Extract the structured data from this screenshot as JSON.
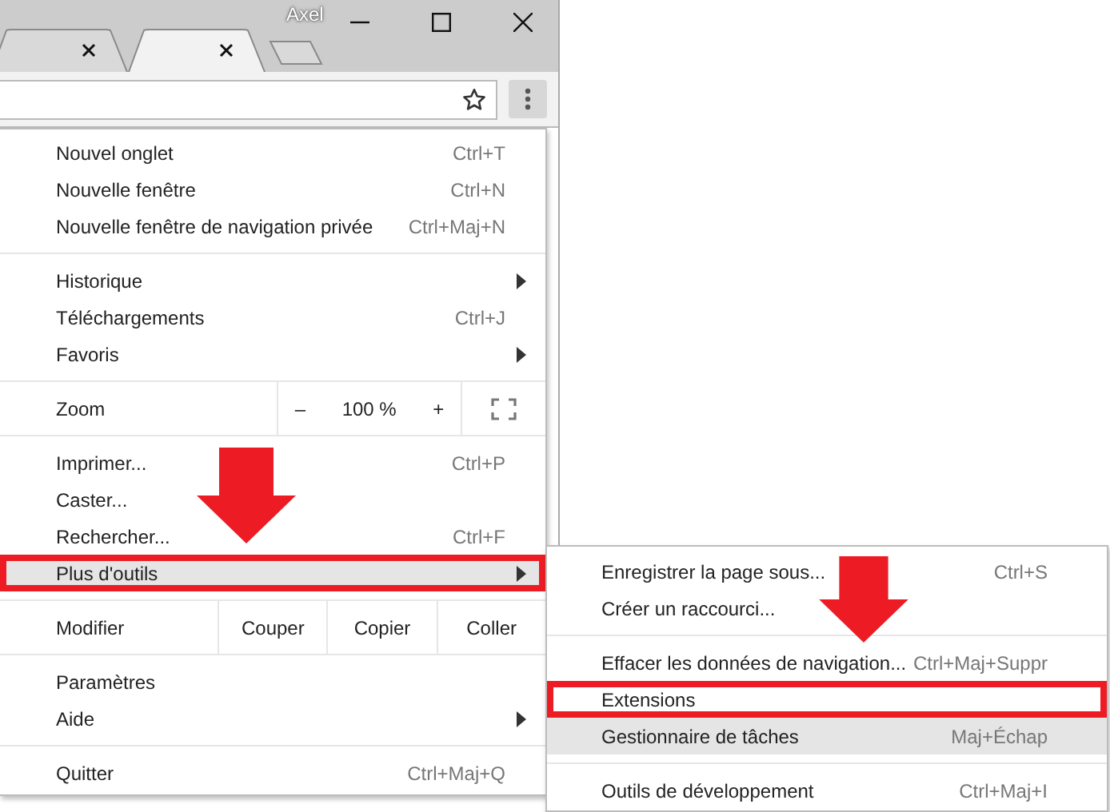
{
  "window": {
    "user": "Axel"
  },
  "tabs": [
    {
      "selected": false
    },
    {
      "selected": true
    }
  ],
  "menu": {
    "items": [
      {
        "kind": "item",
        "label": "Nouvel onglet",
        "shortcut": "Ctrl+T",
        "submenu": false,
        "highlighted": false,
        "outlined": false
      },
      {
        "kind": "item",
        "label": "Nouvelle fenêtre",
        "shortcut": "Ctrl+N",
        "submenu": false,
        "highlighted": false,
        "outlined": false
      },
      {
        "kind": "item",
        "label": "Nouvelle fenêtre de navigation privée",
        "shortcut": "Ctrl+Maj+N",
        "submenu": false,
        "highlighted": false,
        "outlined": false
      },
      {
        "kind": "separator"
      },
      {
        "kind": "item",
        "label": "Historique",
        "submenu": true,
        "highlighted": false,
        "outlined": false
      },
      {
        "kind": "item",
        "label": "Téléchargements",
        "shortcut": "Ctrl+J",
        "submenu": false,
        "highlighted": false,
        "outlined": false
      },
      {
        "kind": "item",
        "label": "Favoris",
        "submenu": true,
        "highlighted": false,
        "outlined": false
      },
      {
        "kind": "separator"
      },
      {
        "kind": "zoom",
        "label": "Zoom",
        "minus": "–",
        "value": "100 %",
        "plus": "+"
      },
      {
        "kind": "separator"
      },
      {
        "kind": "item",
        "label": "Imprimer...",
        "shortcut": "Ctrl+P",
        "submenu": false,
        "highlighted": false,
        "outlined": false
      },
      {
        "kind": "item",
        "label": "Caster...",
        "submenu": false,
        "highlighted": false,
        "outlined": false
      },
      {
        "kind": "item",
        "label": "Rechercher...",
        "shortcut": "Ctrl+F",
        "submenu": false,
        "highlighted": false,
        "outlined": false
      },
      {
        "kind": "item",
        "label": "Plus d'outils",
        "submenu": true,
        "highlighted": true,
        "outlined": true
      },
      {
        "kind": "separator"
      },
      {
        "kind": "edit",
        "label": "Modifier",
        "buttons": [
          "Couper",
          "Copier",
          "Coller"
        ]
      },
      {
        "kind": "separator"
      },
      {
        "kind": "item",
        "label": "Paramètres",
        "submenu": false,
        "highlighted": false,
        "outlined": false
      },
      {
        "kind": "item",
        "label": "Aide",
        "submenu": true,
        "highlighted": false,
        "outlined": false
      },
      {
        "kind": "separator"
      },
      {
        "kind": "item",
        "label": "Quitter",
        "shortcut": "Ctrl+Maj+Q",
        "submenu": false,
        "highlighted": false,
        "outlined": false
      }
    ]
  },
  "submenu": {
    "items": [
      {
        "kind": "item",
        "label": "Enregistrer la page sous...",
        "shortcut": "Ctrl+S",
        "highlighted": false,
        "outlined": false
      },
      {
        "kind": "item",
        "label": "Créer un raccourci...",
        "highlighted": false,
        "outlined": false
      },
      {
        "kind": "separator"
      },
      {
        "kind": "item",
        "label": "Effacer les données de navigation...",
        "shortcut": "Ctrl+Maj+Suppr",
        "highlighted": false,
        "outlined": false
      },
      {
        "kind": "item",
        "label": "Extensions",
        "highlighted": false,
        "outlined": true
      },
      {
        "kind": "item",
        "label": "Gestionnaire de tâches",
        "shortcut": "Maj+Échap",
        "highlighted": true,
        "outlined": false
      },
      {
        "kind": "separator"
      },
      {
        "kind": "item",
        "label": "Outils de développement",
        "shortcut": "Ctrl+Maj+I",
        "highlighted": false,
        "outlined": false
      }
    ]
  }
}
